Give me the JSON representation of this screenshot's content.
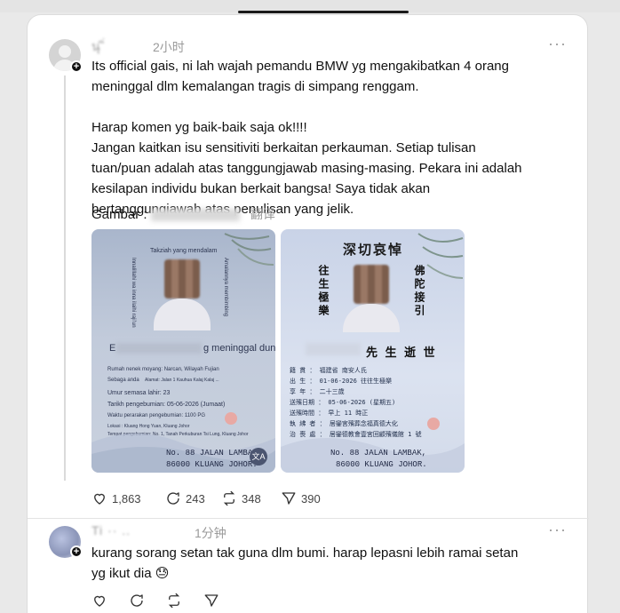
{
  "post": {
    "username": "นุ ิ่",
    "time": "2小时",
    "more": "···",
    "line1": "Its official gais, ni lah wajah pemandu BMW yg mengakibatkan 4 orang",
    "line2": "meninggal dlm kemalangan tragis di simpang renggam.",
    "line3": "Harap komen yg baik-baik saja ok!!!!",
    "line4": "Jangan kaitkan isu sensitiviti berkaitan perkauman. Setiap tulisan",
    "line5": "tuan/puan adalah atas tanggungjawab masing-masing. Pekara ini adalah",
    "line6": "kesilapan individu bukan berkait bangsa! Saya tidak akan",
    "line7": "bertanggungjawab atas penulisan yang jelik.",
    "gambar_label": "Gambar :",
    "translate": "翻译"
  },
  "card_left": {
    "header": "Takziah yang mendalam",
    "left_vert": "Innalillahi wa inna ilaihi raji'un",
    "right_vert": "Amalannya membimbing",
    "name_prefix": "E",
    "name_suffix": "g meninggal dunia",
    "row1": "Rumah nenek moyang: Narcan, Wilayah Fujian",
    "row2": "Sebaga anda",
    "row2b": "Alamat: Jalan 1 Kauhua Kalaj Kalaj ...",
    "row3": "Umur semasa lahir: 23",
    "row4": "Tarikh pengebumian: 05-06-2026 (Jumaat)",
    "row5": "Waktu perarakan pengebumian: 1100 PG",
    "row6": "Lokasi : Kluang Hong Yuan, Kluang Johor",
    "row7": "Tempat pengebumian: No. 1, Tanah Perkuburan Tsi Lung, Kluang Johor",
    "addr1": "No. 88 JALAN LAMBAK,",
    "addr2": "86000 KLUANG JOHOR."
  },
  "card_right": {
    "title": "深切哀悼",
    "vert_left": "往生極樂",
    "vert_right": "佛陀接引",
    "name_suffix": "先 生 逝 世",
    "rows": [
      "籍 貫 ： 福建省  南安人氏",
      "出 生 ： 01-06-2026  往往生極樂",
      "享 年 ： 二十三歲",
      "送殯日期 ： 05-06-2026 (星期五)",
      "送殯時間 ： 早上 11 時正",
      "執 紼 者 ： 居鑾宮殯葬念福真德大化",
      "治 喪 處 ： 居鑾德教會壹宮回顧殯儀館 1 號"
    ],
    "addr1": "No. 88 JALAN LAMBAK,",
    "addr2": "86000 KLUANG JOHOR."
  },
  "actions": {
    "likes": "1,863",
    "comments": "243",
    "reposts": "348",
    "shares": "390"
  },
  "reply": {
    "username": "Ti  ··  ..",
    "time": "1分钟",
    "more": "···",
    "line1": "kurang sorang setan tak guna dlm bumi. harap lepasni lebih ramai setan",
    "line2": "yg ikut dia 😓"
  },
  "colors": {
    "background": "#e9e9e9",
    "card_bg": "#ffffff",
    "text": "#101010",
    "muted": "#9a9a9a"
  }
}
